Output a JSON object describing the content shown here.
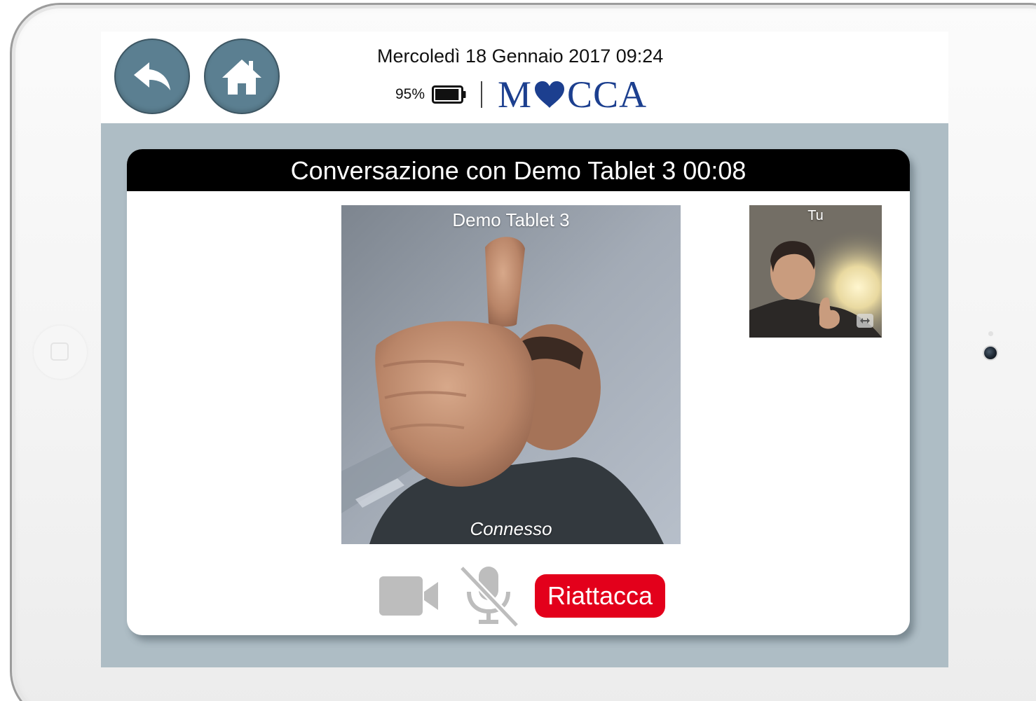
{
  "header": {
    "datetime": "Mercoledì 18 Gennaio 2017 09:24",
    "battery_percent": "95%",
    "battery_level": 0.95,
    "logo_text_left": "M",
    "logo_text_right": "CCA",
    "back_icon": "back-arrow-icon",
    "home_icon": "home-icon"
  },
  "call": {
    "title": "Conversazione con Demo Tablet 3 00:08",
    "remote_name": "Demo Tablet 3",
    "remote_status": "Connesso",
    "self_label": "Tu",
    "hangup_label": "Riattacca",
    "video_icon": "video-camera-icon",
    "mic_icon": "microphone-muted-icon",
    "swap_icon": "swap-camera-icon"
  },
  "colors": {
    "screen_background": "#aebdc5",
    "round_button": "#5b7f91",
    "logo_blue": "#1c3f8f",
    "hangup_red": "#e3001b",
    "title_bar": "#000000",
    "disabled_icon": "#bdbdbd"
  }
}
